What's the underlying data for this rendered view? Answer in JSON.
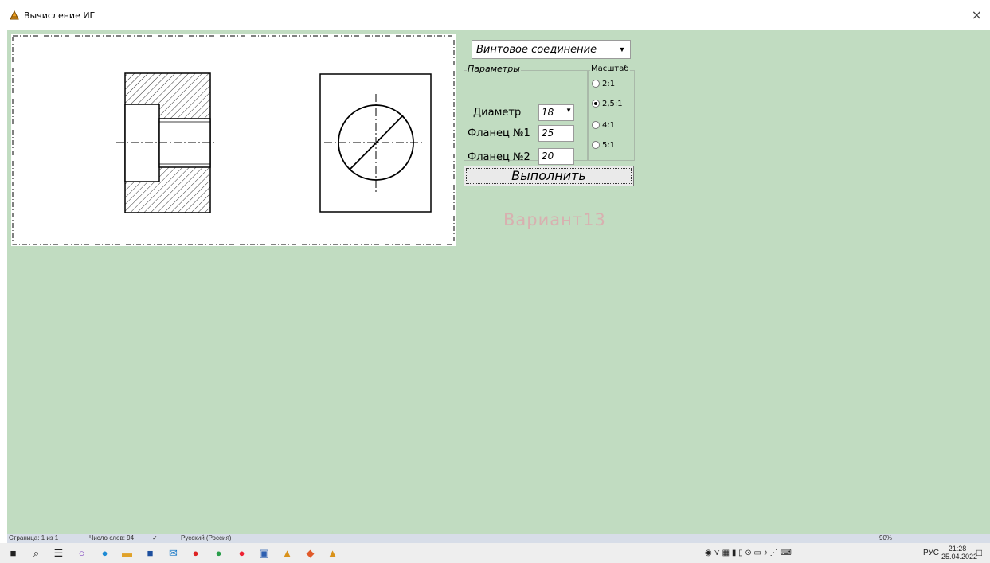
{
  "window": {
    "title": "Вычисление ИГ",
    "close_glyph": "×"
  },
  "combo": {
    "value": "Винтовое соединение",
    "arrow": "▼"
  },
  "params": {
    "legend": "Параметры",
    "diameter_label": "Диаметр",
    "diameter_value": "18",
    "flange1_label": "Фланец №1",
    "flange1_value": "25",
    "flange2_label": "Фланец №2",
    "flange2_value": "20"
  },
  "scale": {
    "legend": "Масштаб",
    "options": [
      {
        "label": "2:1",
        "selected": false
      },
      {
        "label": "2,5:1",
        "selected": true
      },
      {
        "label": "4:1",
        "selected": false
      },
      {
        "label": "5:1",
        "selected": false
      }
    ]
  },
  "run_button": {
    "label": "Выполнить"
  },
  "variant": {
    "text": "Вариант13"
  },
  "statusbar": {
    "page": "Страница: 1 из 1",
    "words": "Число слов: 94",
    "language": "Русский (Россия)",
    "zoom": "90%"
  },
  "taskbar": {
    "lang": "РУС",
    "time": "21:28",
    "date": "25.04.2022"
  },
  "colors": {
    "client_bg": "#c1dcc1",
    "variant_text": "#d8b0b0"
  }
}
